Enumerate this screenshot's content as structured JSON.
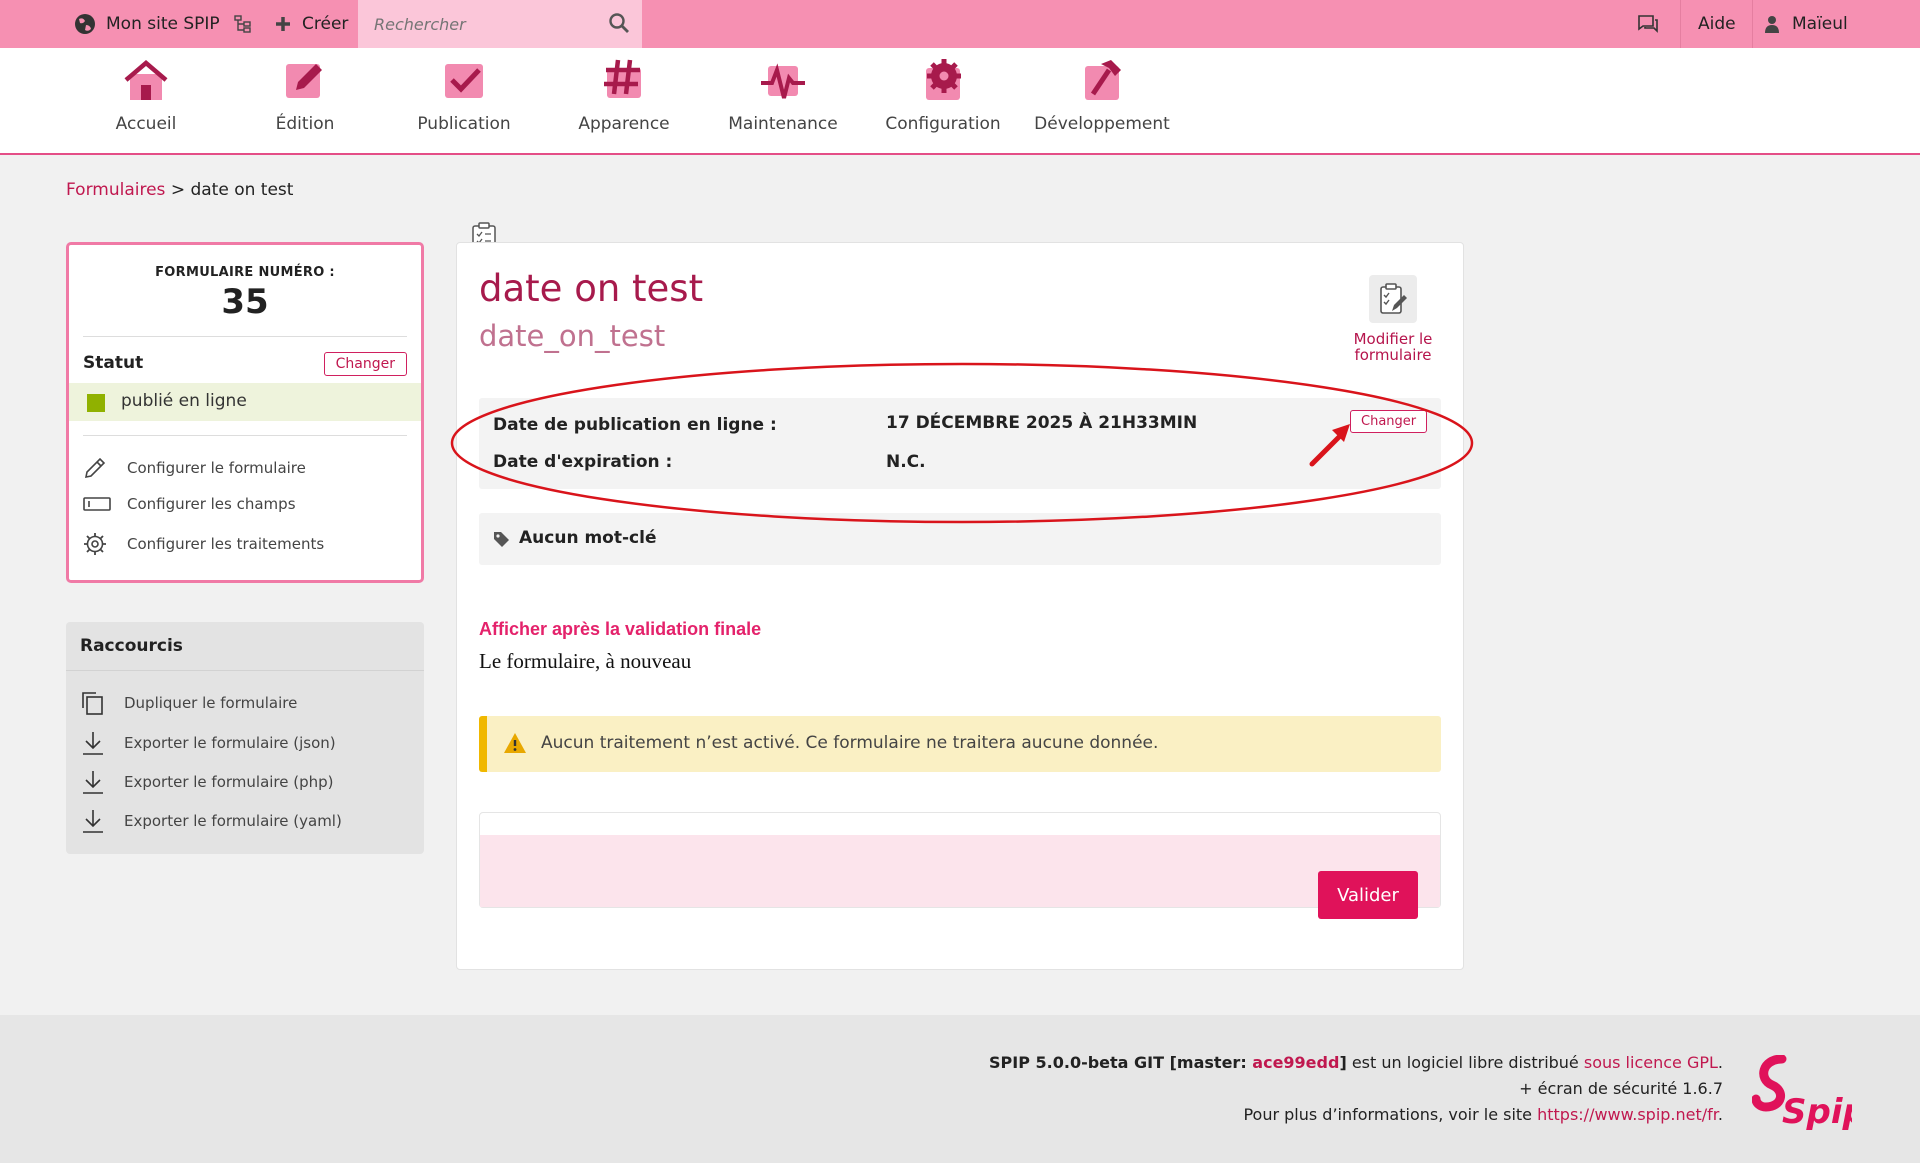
{
  "topbar": {
    "site_name": "Mon site SPIP",
    "create_label": "Créer",
    "search_placeholder": "Rechercher",
    "help_label": "Aide",
    "user_name": "Maïeul"
  },
  "nav": {
    "items": [
      {
        "label": "Accueil"
      },
      {
        "label": "Édition"
      },
      {
        "label": "Publication"
      },
      {
        "label": "Apparence"
      },
      {
        "label": "Maintenance"
      },
      {
        "label": "Configuration"
      },
      {
        "label": "Développement"
      }
    ]
  },
  "breadcrumb": {
    "parent": "Formulaires",
    "separator": ">",
    "current": "date on test"
  },
  "info": {
    "number_label": "FORMULAIRE NUMÉRO :",
    "number": "35",
    "status_label": "Statut",
    "change_label": "Changer",
    "status_value": "publié en ligne",
    "links": [
      {
        "label": "Configurer le formulaire",
        "icon": "pencil-icon"
      },
      {
        "label": "Configurer les champs",
        "icon": "field-icon"
      },
      {
        "label": "Configurer les traitements",
        "icon": "gear-icon"
      }
    ]
  },
  "shortcuts": {
    "title": "Raccourcis",
    "items": [
      {
        "label": "Dupliquer le formulaire",
        "icon": "duplicate-icon"
      },
      {
        "label": "Exporter le formulaire (json)",
        "icon": "download-icon"
      },
      {
        "label": "Exporter le formulaire (php)",
        "icon": "download-icon"
      },
      {
        "label": "Exporter le formulaire (yaml)",
        "icon": "download-icon"
      }
    ]
  },
  "main": {
    "title": "date on test",
    "identifier": "date_on_test",
    "edit_label": "Modifier le formulaire",
    "pub_date_label": "Date de publication en ligne :",
    "pub_date_value": "17 DÉCEMBRE 2025 À 21H33MIN",
    "exp_date_label": "Date d'expiration :",
    "exp_date_value": "N.C.",
    "change_label": "Changer",
    "keywords": "Aucun mot-clé",
    "after_validation_title": "Afficher après la validation finale",
    "after_validation_text": "Le formulaire, à nouveau",
    "warning": "Aucun traitement n’est activé. Ce formulaire ne traitera aucune donnée.",
    "submit_label": "Valider"
  },
  "footer": {
    "version_prefix": "SPIP 5.0.0-beta GIT [master: ",
    "commit": "ace99edd",
    "version_suffix": "] est un logiciel libre distribué ",
    "license_link": "sous licence GPL",
    "period": ".",
    "security": "+ écran de sécurité 1.6.7",
    "more_info": "Pour plus d’informations, voir le site ",
    "site_link": "https://www.spip.net/fr",
    "logo_text": "Spip"
  },
  "colors": {
    "brand": "#e0125a",
    "topbar": "#f690b2",
    "status_published": "#90b100",
    "annotation": "#d9141b"
  }
}
